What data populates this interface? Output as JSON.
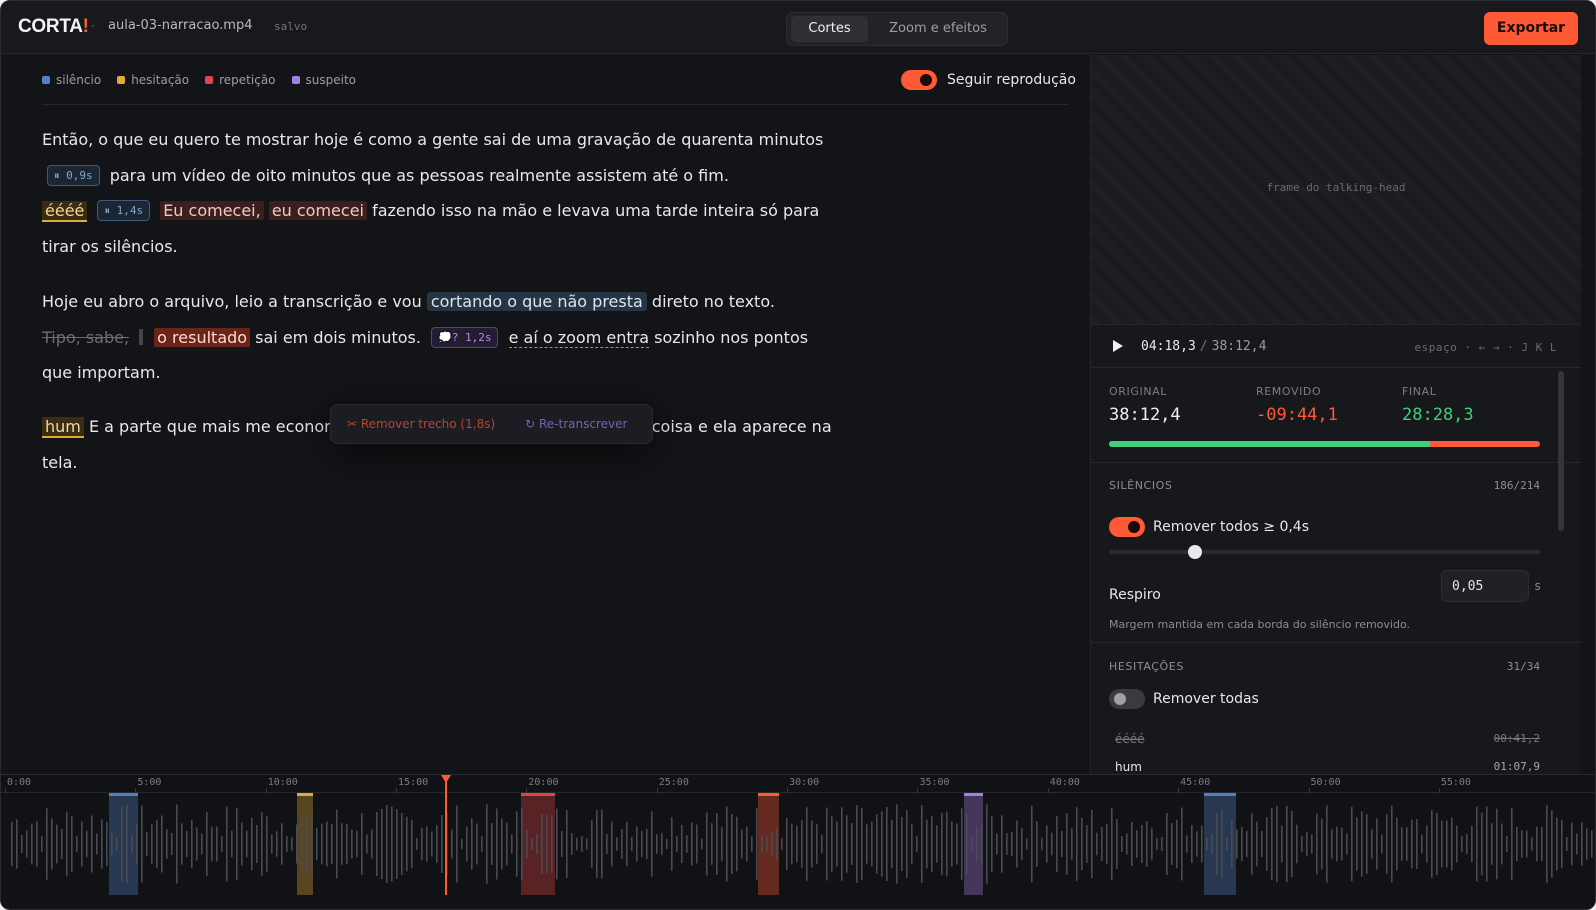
{
  "header": {
    "logo_main": "CORTA",
    "logo_bang": "!",
    "separator": "·",
    "file_name": "aula-03-narracao.mp4",
    "save_status": "salvo",
    "tabs": [
      {
        "label": "Cortes"
      },
      {
        "label": "Zoom e efeitos"
      }
    ],
    "export_label": "Exportar"
  },
  "legend": [
    {
      "label": "silêncio",
      "color": "#4f82c0"
    },
    {
      "label": "hesitação",
      "color": "#e0a93a"
    },
    {
      "label": "repetição",
      "color": "#e04545"
    },
    {
      "label": "suspeito",
      "color": "#a47ee0"
    }
  ],
  "follow_label": "Seguir reprodução",
  "transcript": {
    "p1": {
      "t1": "Então, o que eu quero te mostrar hoje é como a gente sai de uma gravação de quarenta minutos",
      "chip1": "⏸ 0,9s",
      "t2": "para um vídeo de oito minutos que as pessoas realmente assistem até o fim.",
      "hes1": "éééé",
      "chip2": "⏸ 1,4s",
      "rep1": "Eu comecei,",
      "rep2": "eu comecei",
      "t3": "fazendo isso na mão e levava uma tarde inteira só para tirar os silêncios."
    },
    "p2": {
      "t1": "Hoje eu abro o arquivo, leio a transcrição e vou",
      "sel": "cortando o que não presta",
      "t2": "direto no texto.",
      "strike": "Tipo, sabe,",
      "rep": "o resultado",
      "t3": "sai em dois minutos.",
      "chip": "💭? 1,2s",
      "dash": "e aí o zoom entra",
      "t4": "sozinho nos pontos que importam."
    },
    "p3": {
      "hes": "hum",
      "t1": "E a parte que mais me econom",
      "t2": "coisa e ela aparece na tela."
    }
  },
  "popup": {
    "remove": "✂ Remover trecho (1,8s)",
    "retranscribe": "↻ Re-transcrever"
  },
  "preview": {
    "label": "frame do talking-head"
  },
  "player": {
    "current": "04:18,3",
    "sep": "/",
    "total": "38:12,4",
    "shortcuts": "espaço · ← → · J K L"
  },
  "stats": {
    "original_label": "ORIGINAL",
    "original": "38:12,4",
    "removed_label": "REMOVIDO",
    "removed": "-09:44,1",
    "final_label": "FINAL",
    "final": "28:28,3",
    "kept_fraction": 0.745
  },
  "silences": {
    "title": "SILÊNCIOS",
    "count": "186/214",
    "toggle_label": "Remover todos ≥ 0,4s",
    "slider_value": 0.4,
    "breath_label": "Respiro",
    "breath_value": "0,05",
    "breath_unit": "s",
    "help": "Margem mantida em cada borda do silêncio removido."
  },
  "hesitations": {
    "title": "HESITAÇÕES",
    "count": "31/34",
    "toggle_label": "Remover todas",
    "items": [
      {
        "word": "éééé",
        "time": "00:41,2"
      },
      {
        "word": "hum",
        "time": "01:07,9"
      }
    ]
  },
  "timeline": {
    "ticks": [
      "0:00",
      "5:00",
      "10:00",
      "15:00",
      "20:00",
      "25:00",
      "30:00",
      "35:00",
      "40:00",
      "45:00",
      "50:00",
      "55:00"
    ],
    "playhead_min": 16.9,
    "regions": [
      {
        "type": "silence",
        "start_min": 4.0,
        "end_min": 5.1,
        "color": "#4f82c0"
      },
      {
        "type": "hesitation",
        "start_min": 11.2,
        "end_min": 11.8,
        "color": "#e0a93a"
      },
      {
        "type": "repetition",
        "start_min": 19.8,
        "end_min": 21.1,
        "color": "#e04545"
      },
      {
        "type": "repetition",
        "start_min": 28.9,
        "end_min": 29.7,
        "color": "#ff5a36"
      },
      {
        "type": "suspect",
        "start_min": 36.8,
        "end_min": 37.5,
        "color": "#a47ee0"
      },
      {
        "type": "silence",
        "start_min": 46.0,
        "end_min": 47.2,
        "color": "#4f82c0"
      }
    ]
  }
}
